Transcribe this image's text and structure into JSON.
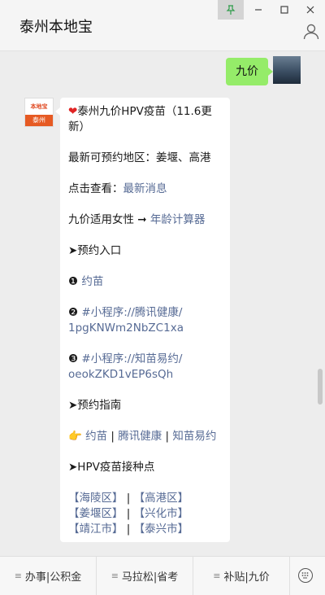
{
  "window": {
    "title": "泰州本地宝",
    "pin_icon": "pin-icon",
    "min_icon": "minimize-icon",
    "max_icon": "maximize-icon",
    "close_icon": "close-icon"
  },
  "chat": {
    "sent_message": "九价",
    "bot_avatar": {
      "top_text": "本地宝",
      "bottom_text": "泰州"
    },
    "reply": {
      "title_line1": "泰州九价HPV疫苗（11.6更",
      "title_line2": "新）",
      "latest_area": "最新可预约地区：姜堰、高港",
      "click_prefix": "点击查看：",
      "click_link": "最新消息",
      "age_prefix": "九价适用女性 ➞ ",
      "age_link": "年龄计算器",
      "entry_header": "➤预约入口",
      "entry1_num": "❶",
      "entry1_link": "约苗",
      "entry2_num": "❷",
      "entry2_link_line1": "#小程序://腾讯健康/",
      "entry2_link_line2": "1pgKNWm2NbZC1xa",
      "entry3_num": "❸",
      "entry3_link_line1": "#小程序://知苗易约/",
      "entry3_link_line2": "oeokZKD1vEP6sQh",
      "guide_header": "➤预约指南",
      "guide_hand": "👉",
      "guide_link1": "约苗",
      "guide_link2": "腾讯健康",
      "guide_link3": "知苗易约",
      "guide_sep": " | ",
      "sites_header": "➤HPV疫苗接种点",
      "districts": [
        [
          "【海陵区】",
          "【高港区】"
        ],
        [
          "【姜堰区】",
          "【兴化市】"
        ],
        [
          "【靖江市】",
          "【泰兴市】"
        ]
      ],
      "district_sep": " | "
    }
  },
  "bottom_menu": {
    "items": [
      "办事|公积金",
      "马拉松|省考",
      "补贴|九价"
    ],
    "menu_icon": "menu-lines-icon",
    "keyboard_icon": "keyboard-icon"
  },
  "colors": {
    "link": "#576b95",
    "sent_bubble": "#95ec69",
    "heart": "#e02424",
    "brand": "#e65a23"
  }
}
